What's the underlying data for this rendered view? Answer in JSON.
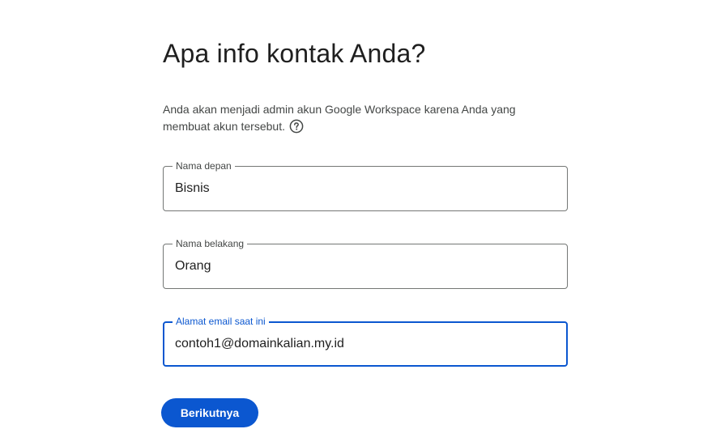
{
  "header": {
    "title": "Apa info kontak Anda?"
  },
  "description": {
    "text": "Anda akan menjadi admin akun Google Workspace karena Anda yang membuat akun tersebut.",
    "help_icon": "help-circle-icon"
  },
  "form": {
    "first_name": {
      "label": "Nama depan",
      "value": "Bisnis"
    },
    "last_name": {
      "label": "Nama belakang",
      "value": "Orang"
    },
    "email": {
      "label": "Alamat email saat ini",
      "value": "contoh1@domainkalian.my.id",
      "focused": true
    }
  },
  "actions": {
    "next_label": "Berikutnya"
  },
  "colors": {
    "accent": "#0b57d0",
    "border": "#747775",
    "text": "#1f1f1f",
    "secondary_text": "#444746"
  }
}
